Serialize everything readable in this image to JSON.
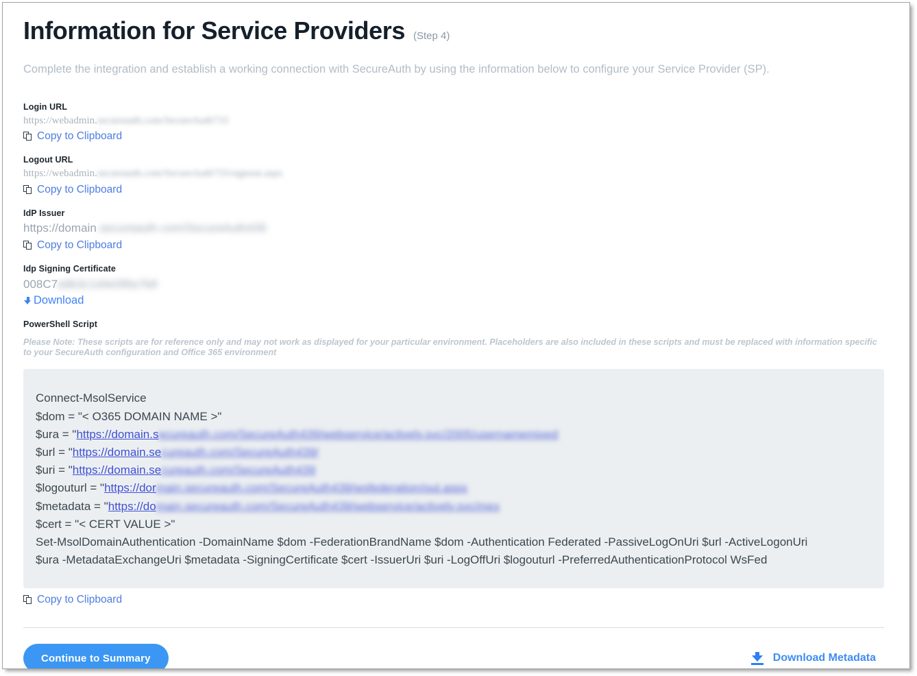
{
  "header": {
    "title": "Information for Service Providers",
    "step": "(Step 4)",
    "subtitle": "Complete the integration and establish a working connection with SecureAuth by using the information below to configure your Service Provider (SP)."
  },
  "fields": {
    "login_url": {
      "label": "Login URL",
      "value_visible": "https://webadmin.",
      "value_redacted": "secureauth.com/SecureAuth733",
      "copy_label": "Copy to Clipboard"
    },
    "logout_url": {
      "label": "Logout URL",
      "value_visible": "https://webadmin.",
      "value_redacted": "secureauth.com/SecureAuth733/signout.aspx",
      "copy_label": "Copy to Clipboard"
    },
    "idp_issuer": {
      "label": "IdP Issuer",
      "value_visible": "https://domain",
      "value_redacted": ".secureauth.com/SecureAuth439",
      "copy_label": "Copy to Clipboard"
    },
    "signing_certificate": {
      "label": "Idp Signing Certificate",
      "value_visible": "008C7",
      "value_redacted": "a9b3c1d4e5f6a7b8",
      "download_label": "Download"
    }
  },
  "powershell": {
    "label": "PowerShell Script",
    "note": "Please Note: These scripts are for reference only and may not work as displayed for your particular environment. Placeholders are also included in these scripts and must be replaced with information specific to your SecureAuth configuration and Office 365 environment",
    "copy_label": "Copy to Clipboard",
    "lines": [
      {
        "type": "plain",
        "text": "Connect-MsolService"
      },
      {
        "type": "plain",
        "text": "$dom = \"< O365 DOMAIN NAME >\""
      },
      {
        "type": "link",
        "prefix": "$ura = \"",
        "link_visible": "https://domain.s",
        "link_redacted": "ecureauth.com/SecureAuth439/webservice/actively.svc/2005/usernamemixed"
      },
      {
        "type": "link",
        "prefix": "$url = \"",
        "link_visible": "https://domain.se",
        "link_redacted": "cureauth.com/SecureAuth439/"
      },
      {
        "type": "link",
        "prefix": "$uri = \"",
        "link_visible": "https://domain.se",
        "link_redacted": "cureauth.com/SecureAuth439"
      },
      {
        "type": "link",
        "prefix": "$logouturl = \"",
        "link_visible": "https://dor",
        "link_redacted": "main.secureauth.com/SecureAuth439/wsfederation/out.aspx"
      },
      {
        "type": "link",
        "prefix": "$metadata = \"",
        "link_visible": "https://do",
        "link_redacted": "main.secureauth.com/SecureAuth439/webservice/actively.svc/mex"
      },
      {
        "type": "plain",
        "text": "$cert = \"< CERT VALUE >\""
      },
      {
        "type": "plain",
        "text": "Set-MsolDomainAuthentication -DomainName $dom -FederationBrandName $dom -Authentication Federated -PassiveLogOnUri $url -ActiveLogonUri"
      },
      {
        "type": "plain",
        "text": "$ura -MetadataExchangeUri $metadata -SigningCertificate $cert -IssuerUri $uri -LogOffUri $logouturl -PreferredAuthenticationProtocol WsFed"
      }
    ]
  },
  "footer": {
    "continue_label": "Continue to Summary",
    "download_metadata_label": "Download Metadata"
  },
  "colors": {
    "accent_blue": "#3b97f3",
    "link_blue": "#4d7ce0",
    "script_bg": "#eceff1",
    "title": "#15202b",
    "muted": "#b2bcc6"
  }
}
